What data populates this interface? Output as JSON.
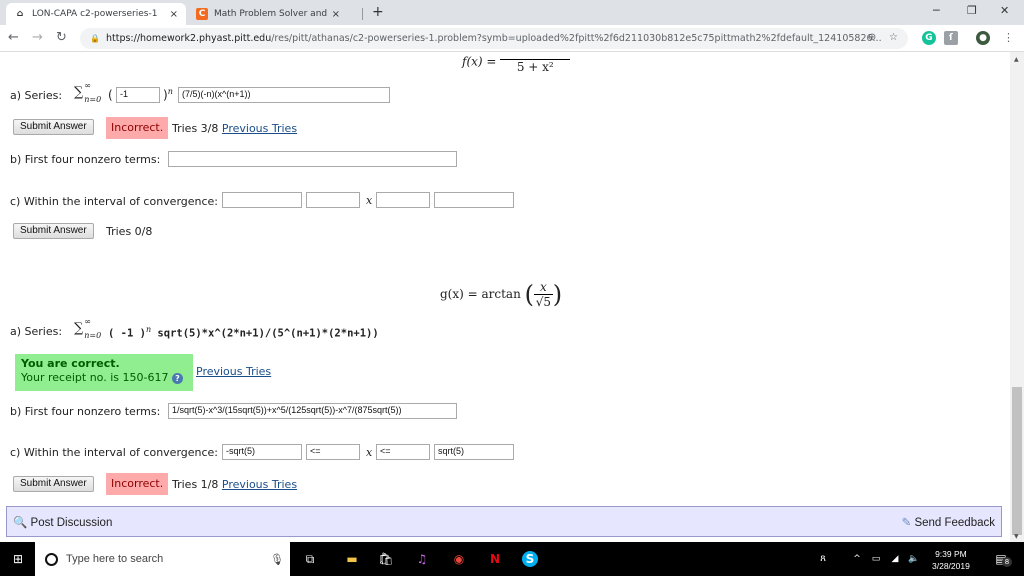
{
  "browser": {
    "tabs": [
      {
        "title": "LON-CAPA c2-powerseries-1",
        "active": true,
        "favicon": "loncapa-icon"
      },
      {
        "title": "Math Problem Solver and Calcula",
        "active": false,
        "favicon": "cymath-icon"
      }
    ],
    "close_glyph": "×",
    "new_tab_glyph": "+",
    "url_host": "https://homework2.phyast.pitt.edu",
    "url_path": "/res/pitt/athanas/c2-powerseries-1.problem?symb=uploaded%2fpitt%2f6d211030b812e5c75pittmath2%2fdefault_124105826..."
  },
  "problem1": {
    "function_label": "f(x) =",
    "function_denominator": "5 + x²",
    "part_a": {
      "label": "a) Series:",
      "sum_symbol": "∑",
      "sum_upper": "∞",
      "sum_lower": "n=0",
      "open_paren": "(",
      "close_paren": ")",
      "exponent": "n",
      "base_value": "-1",
      "term_value": "(7/5)(-n)(x^(n+1))"
    },
    "submit_label": "Submit Answer",
    "status": "Incorrect.",
    "tries": "Tries 3/8",
    "previous_tries": "Previous Tries",
    "part_b": {
      "label": "b) First four nonzero terms:",
      "value": ""
    },
    "part_c": {
      "label": "c) Within the interval of convergence:",
      "var": "x",
      "values": [
        "",
        "",
        "",
        ""
      ]
    },
    "submit2_label": "Submit Answer",
    "tries2": "Tries 0/8"
  },
  "problem2": {
    "function_label": "g(x) = arctan",
    "frac_num": "x",
    "frac_den": "√5",
    "part_a": {
      "label": "a) Series:",
      "sum_symbol": "∑",
      "sum_upper": "∞",
      "sum_lower": "n=0",
      "base_text": "( -1 )",
      "exponent": "n",
      "term_text": "sqrt(5)*x^(2*n+1)/(5^(n+1)*(2*n+1))"
    },
    "correct_title": "You are correct.",
    "receipt": "Your receipt no. is 150-617",
    "help_glyph": "?",
    "previous_tries": "Previous Tries",
    "part_b": {
      "label": "b) First four nonzero terms:",
      "value": "1/sqrt(5)-x^3/(15sqrt(5))+x^5/(125sqrt(5))-x^7/(875sqrt(5))"
    },
    "part_c": {
      "label": "c) Within the interval of convergence:",
      "var": "x",
      "values": [
        "-sqrt(5)",
        "<=",
        "<=",
        "sqrt(5)"
      ]
    },
    "submit_label": "Submit Answer",
    "status": "Incorrect.",
    "tries": "Tries 1/8",
    "previous_tries2": "Previous Tries"
  },
  "footer": {
    "post_discussion": "Post Discussion",
    "send_feedback": "Send Feedback"
  },
  "taskbar": {
    "search_placeholder": "Type here to search",
    "time": "9:39 PM",
    "date": "3/28/2019",
    "notifications": "8"
  }
}
